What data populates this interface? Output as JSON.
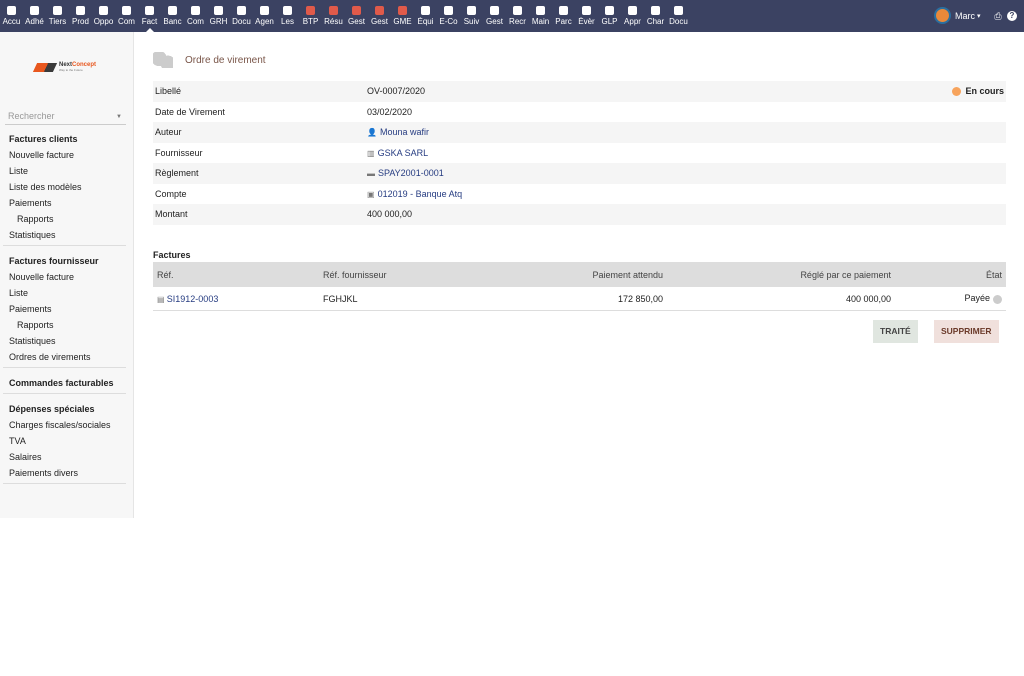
{
  "topbar": {
    "items": [
      "Accu",
      "Adhé",
      "Tiers",
      "Prod",
      "Oppo",
      "Com",
      "Fact",
      "Banc",
      "Com",
      "GRH",
      "Docu",
      "Agen",
      "Les",
      "BTP",
      "Résu",
      "Gest",
      "Gest",
      "GME",
      "Équi",
      "E-Co",
      "Suiv",
      "Gest",
      "Recr",
      "Main",
      "Parc",
      "Évèr",
      "GLP",
      "Appr",
      "Char",
      "Docu"
    ],
    "active": 6,
    "user": "Marc"
  },
  "logo": {
    "name1": "Next",
    "name2": "Concept",
    "tagline": "Way to the Future"
  },
  "search": {
    "placeholder": "Rechercher"
  },
  "sidebar": [
    {
      "title": "Factures clients",
      "items": [
        {
          "label": "Nouvelle facture"
        },
        {
          "label": "Liste"
        },
        {
          "label": "Liste des modèles"
        },
        {
          "label": "Paiements"
        },
        {
          "label": "Rapports",
          "sub": true
        },
        {
          "label": "Statistiques"
        }
      ]
    },
    {
      "title": "Factures fournisseur",
      "items": [
        {
          "label": "Nouvelle facture"
        },
        {
          "label": "Liste"
        },
        {
          "label": "Paiements"
        },
        {
          "label": "Rapports",
          "sub": true
        },
        {
          "label": "Statistiques"
        },
        {
          "label": "Ordres de virements"
        }
      ]
    },
    {
      "title": "Commandes facturables",
      "items": []
    },
    {
      "title": "Dépenses spéciales",
      "items": [
        {
          "label": "Charges fiscales/sociales"
        },
        {
          "label": "TVA"
        },
        {
          "label": "Salaires"
        },
        {
          "label": "Paiements divers"
        }
      ]
    }
  ],
  "page": {
    "title": "Ordre de virement",
    "status": "En cours",
    "status_color": "#f7a35c",
    "fields": [
      {
        "label": "Libellé",
        "value": "OV-0007/2020"
      },
      {
        "label": "Date de Virement",
        "value": "03/02/2020"
      },
      {
        "label": "Auteur",
        "value": "Mouna wafir",
        "icon": "user-icon",
        "glyph": "👤",
        "link": true
      },
      {
        "label": "Fournisseur",
        "value": "GSKA SARL",
        "icon": "company-icon",
        "glyph": "▥",
        "link": true
      },
      {
        "label": "Règlement",
        "value": "SPAY2001-0001",
        "icon": "payment-icon",
        "glyph": "▬",
        "link": true
      },
      {
        "label": "Compte",
        "value": "012019 - Banque Atq",
        "icon": "bank-account-icon",
        "glyph": "▣",
        "link": true
      },
      {
        "label": "Montant",
        "value": "400 000,00"
      }
    ]
  },
  "factures": {
    "title": "Factures",
    "headers": [
      "Réf.",
      "Réf. fournisseur",
      "Paiement attendu",
      "Réglé par ce paiement",
      "État"
    ],
    "rows": [
      [
        "SI1912-0003",
        "FGHJKL",
        "172 850,00",
        "400 000,00",
        "Payée"
      ]
    ]
  },
  "buttons": {
    "traite": "TRAITÉ",
    "supprimer": "SUPPRIMER"
  }
}
